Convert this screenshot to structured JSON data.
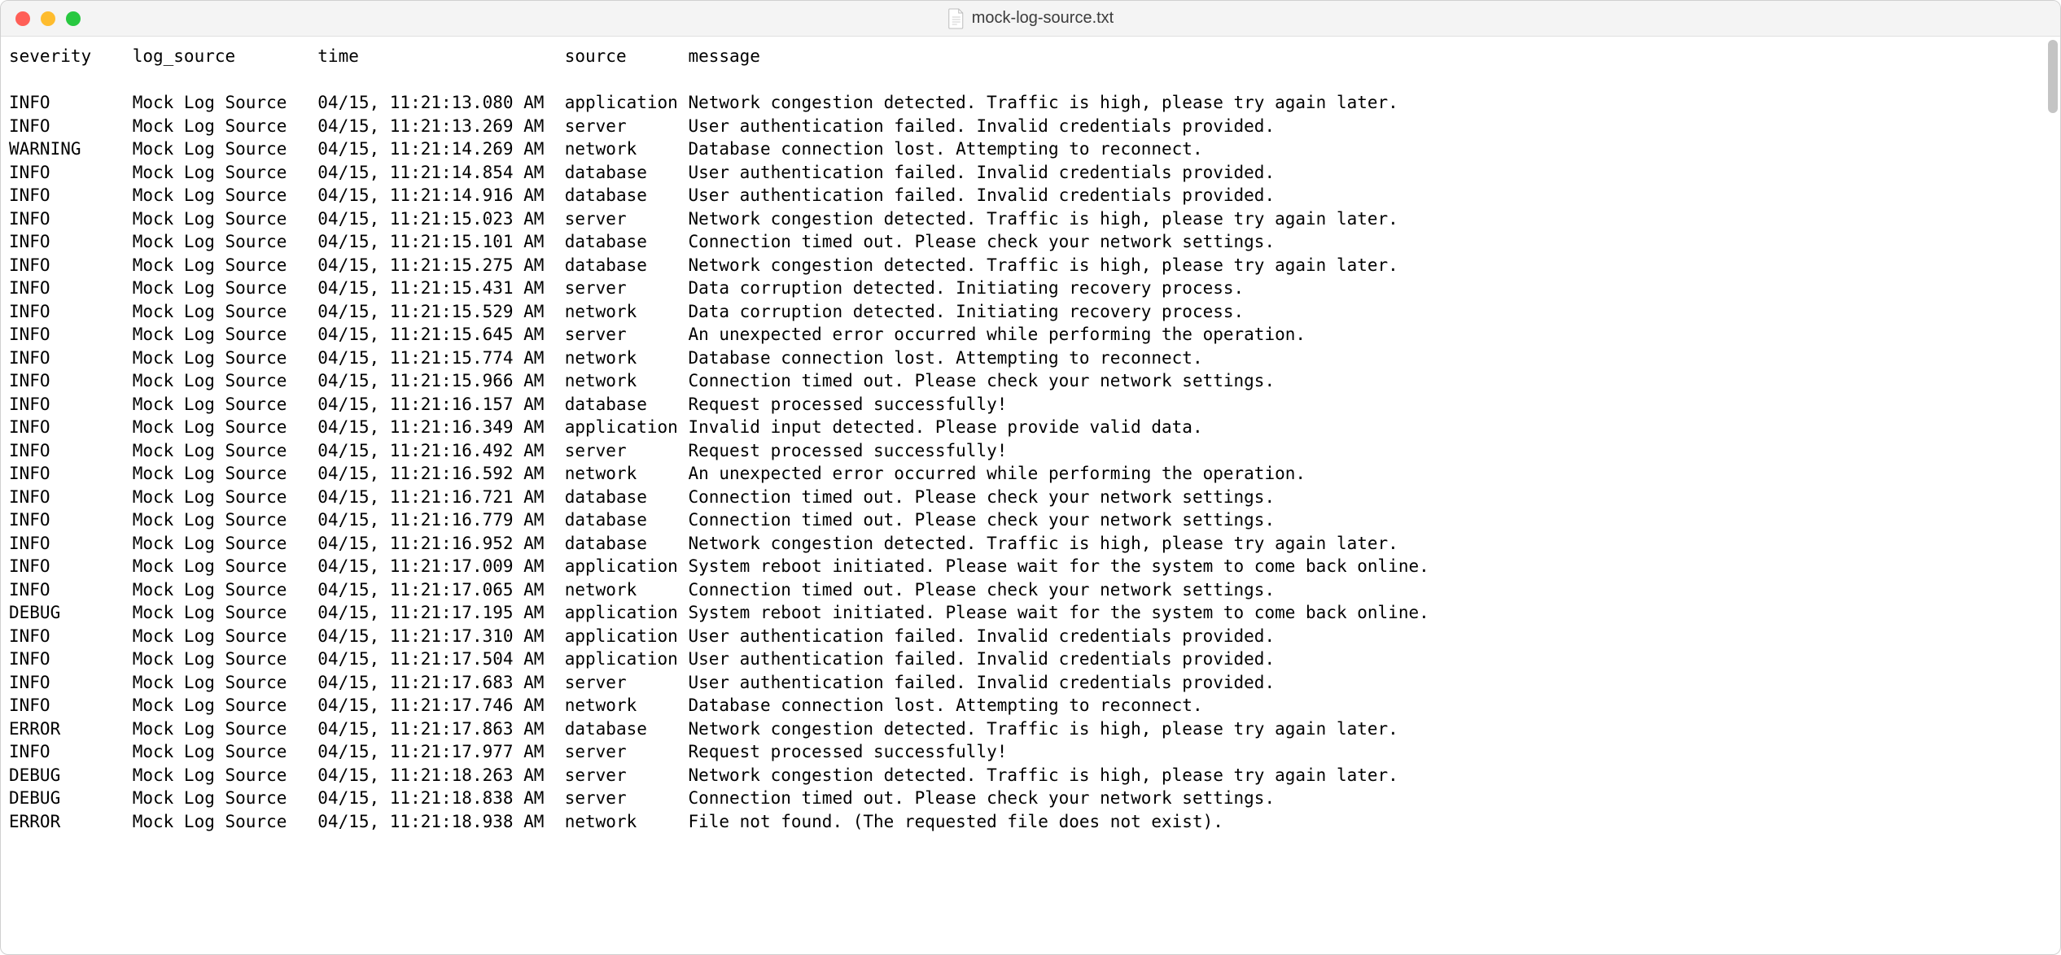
{
  "window": {
    "title": "mock-log-source.txt"
  },
  "columns": {
    "severity": "severity",
    "log_source": "log_source",
    "time": "time",
    "source": "source",
    "message": "message"
  },
  "col_widths": {
    "severity": 12,
    "log_source": 18,
    "time": 24,
    "source": 12
  },
  "rows": [
    {
      "severity": "INFO",
      "log_source": "Mock Log Source",
      "time": "04/15, 11:21:13.080 AM",
      "source": "application",
      "message": "Network congestion detected. Traffic is high, please try again later."
    },
    {
      "severity": "INFO",
      "log_source": "Mock Log Source",
      "time": "04/15, 11:21:13.269 AM",
      "source": "server",
      "message": "User authentication failed. Invalid credentials provided."
    },
    {
      "severity": "WARNING",
      "log_source": "Mock Log Source",
      "time": "04/15, 11:21:14.269 AM",
      "source": "network",
      "message": "Database connection lost. Attempting to reconnect."
    },
    {
      "severity": "INFO",
      "log_source": "Mock Log Source",
      "time": "04/15, 11:21:14.854 AM",
      "source": "database",
      "message": "User authentication failed. Invalid credentials provided."
    },
    {
      "severity": "INFO",
      "log_source": "Mock Log Source",
      "time": "04/15, 11:21:14.916 AM",
      "source": "database",
      "message": "User authentication failed. Invalid credentials provided."
    },
    {
      "severity": "INFO",
      "log_source": "Mock Log Source",
      "time": "04/15, 11:21:15.023 AM",
      "source": "server",
      "message": "Network congestion detected. Traffic is high, please try again later."
    },
    {
      "severity": "INFO",
      "log_source": "Mock Log Source",
      "time": "04/15, 11:21:15.101 AM",
      "source": "database",
      "message": "Connection timed out. Please check your network settings."
    },
    {
      "severity": "INFO",
      "log_source": "Mock Log Source",
      "time": "04/15, 11:21:15.275 AM",
      "source": "database",
      "message": "Network congestion detected. Traffic is high, please try again later."
    },
    {
      "severity": "INFO",
      "log_source": "Mock Log Source",
      "time": "04/15, 11:21:15.431 AM",
      "source": "server",
      "message": "Data corruption detected. Initiating recovery process."
    },
    {
      "severity": "INFO",
      "log_source": "Mock Log Source",
      "time": "04/15, 11:21:15.529 AM",
      "source": "network",
      "message": "Data corruption detected. Initiating recovery process."
    },
    {
      "severity": "INFO",
      "log_source": "Mock Log Source",
      "time": "04/15, 11:21:15.645 AM",
      "source": "server",
      "message": "An unexpected error occurred while performing the operation."
    },
    {
      "severity": "INFO",
      "log_source": "Mock Log Source",
      "time": "04/15, 11:21:15.774 AM",
      "source": "network",
      "message": "Database connection lost. Attempting to reconnect."
    },
    {
      "severity": "INFO",
      "log_source": "Mock Log Source",
      "time": "04/15, 11:21:15.966 AM",
      "source": "network",
      "message": "Connection timed out. Please check your network settings."
    },
    {
      "severity": "INFO",
      "log_source": "Mock Log Source",
      "time": "04/15, 11:21:16.157 AM",
      "source": "database",
      "message": "Request processed successfully!"
    },
    {
      "severity": "INFO",
      "log_source": "Mock Log Source",
      "time": "04/15, 11:21:16.349 AM",
      "source": "application",
      "message": "Invalid input detected. Please provide valid data."
    },
    {
      "severity": "INFO",
      "log_source": "Mock Log Source",
      "time": "04/15, 11:21:16.492 AM",
      "source": "server",
      "message": "Request processed successfully!"
    },
    {
      "severity": "INFO",
      "log_source": "Mock Log Source",
      "time": "04/15, 11:21:16.592 AM",
      "source": "network",
      "message": "An unexpected error occurred while performing the operation."
    },
    {
      "severity": "INFO",
      "log_source": "Mock Log Source",
      "time": "04/15, 11:21:16.721 AM",
      "source": "database",
      "message": "Connection timed out. Please check your network settings."
    },
    {
      "severity": "INFO",
      "log_source": "Mock Log Source",
      "time": "04/15, 11:21:16.779 AM",
      "source": "database",
      "message": "Connection timed out. Please check your network settings."
    },
    {
      "severity": "INFO",
      "log_source": "Mock Log Source",
      "time": "04/15, 11:21:16.952 AM",
      "source": "database",
      "message": "Network congestion detected. Traffic is high, please try again later."
    },
    {
      "severity": "INFO",
      "log_source": "Mock Log Source",
      "time": "04/15, 11:21:17.009 AM",
      "source": "application",
      "message": "System reboot initiated. Please wait for the system to come back online."
    },
    {
      "severity": "INFO",
      "log_source": "Mock Log Source",
      "time": "04/15, 11:21:17.065 AM",
      "source": "network",
      "message": "Connection timed out. Please check your network settings."
    },
    {
      "severity": "DEBUG",
      "log_source": "Mock Log Source",
      "time": "04/15, 11:21:17.195 AM",
      "source": "application",
      "message": "System reboot initiated. Please wait for the system to come back online."
    },
    {
      "severity": "INFO",
      "log_source": "Mock Log Source",
      "time": "04/15, 11:21:17.310 AM",
      "source": "application",
      "message": "User authentication failed. Invalid credentials provided."
    },
    {
      "severity": "INFO",
      "log_source": "Mock Log Source",
      "time": "04/15, 11:21:17.504 AM",
      "source": "application",
      "message": "User authentication failed. Invalid credentials provided."
    },
    {
      "severity": "INFO",
      "log_source": "Mock Log Source",
      "time": "04/15, 11:21:17.683 AM",
      "source": "server",
      "message": "User authentication failed. Invalid credentials provided."
    },
    {
      "severity": "INFO",
      "log_source": "Mock Log Source",
      "time": "04/15, 11:21:17.746 AM",
      "source": "network",
      "message": "Database connection lost. Attempting to reconnect."
    },
    {
      "severity": "ERROR",
      "log_source": "Mock Log Source",
      "time": "04/15, 11:21:17.863 AM",
      "source": "database",
      "message": "Network congestion detected. Traffic is high, please try again later."
    },
    {
      "severity": "INFO",
      "log_source": "Mock Log Source",
      "time": "04/15, 11:21:17.977 AM",
      "source": "server",
      "message": "Request processed successfully!"
    },
    {
      "severity": "DEBUG",
      "log_source": "Mock Log Source",
      "time": "04/15, 11:21:18.263 AM",
      "source": "server",
      "message": "Network congestion detected. Traffic is high, please try again later."
    },
    {
      "severity": "DEBUG",
      "log_source": "Mock Log Source",
      "time": "04/15, 11:21:18.838 AM",
      "source": "server",
      "message": "Connection timed out. Please check your network settings."
    },
    {
      "severity": "ERROR",
      "log_source": "Mock Log Source",
      "time": "04/15, 11:21:18.938 AM",
      "source": "network",
      "message": "File not found. (The requested file does not exist)."
    }
  ]
}
